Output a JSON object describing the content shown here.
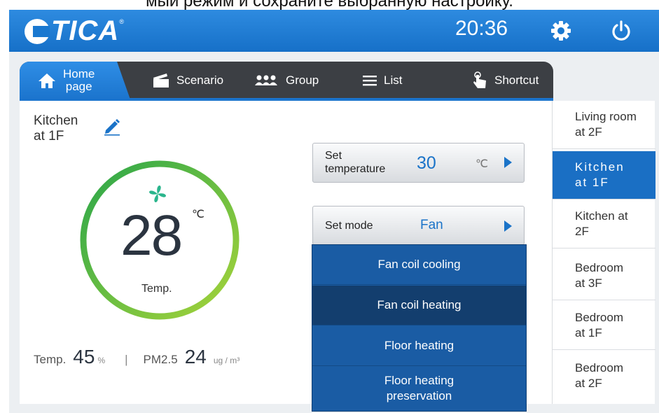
{
  "caption": "мый режим и сохраните выбранную настройку.",
  "header": {
    "logo": "TICA",
    "logo_reg": "®",
    "time": "20:36",
    "settings_icon": "gear-icon",
    "power_icon": "power-icon",
    "color": "#1a78d0"
  },
  "tabs": [
    {
      "label": "Home\npage",
      "icon": "home-icon",
      "active": true
    },
    {
      "label": "Scenario",
      "icon": "clapperboard-icon"
    },
    {
      "label": "Group",
      "icon": "group-icon"
    },
    {
      "label": "List",
      "icon": "list-icon"
    },
    {
      "label": "Shortcut",
      "icon": "tap-icon"
    }
  ],
  "main": {
    "room_title": "Kitchen\nat 1F",
    "edit_icon": "pencil-icon",
    "gauge": {
      "value": "28",
      "unit": "℃",
      "label": "Temp.",
      "ring_colors": [
        "#2aa64a",
        "#a7d43a"
      ]
    },
    "fan_icon": "fan-icon",
    "stats": {
      "temp_label": "Temp.",
      "humidity_value": "45",
      "humidity_unit": "%",
      "separator": "|",
      "pm_label": "PM2.5",
      "pm_value": "24",
      "pm_unit": "ug / m³"
    },
    "set_temperature": {
      "label": "Set\ntemperature",
      "value": "30",
      "unit": "℃"
    },
    "set_mode": {
      "label": "Set mode",
      "value": "Fan"
    },
    "mode_options": [
      {
        "label": "Fan coil cooling"
      },
      {
        "label": "Fan coil heating",
        "selected": true
      },
      {
        "label": "Floor heating"
      },
      {
        "label": "Floor heating\npreservation"
      }
    ]
  },
  "rooms": [
    {
      "label": "Living room\nat 2F"
    },
    {
      "label": "Kitchen\nat 1F",
      "active": true
    },
    {
      "label": "Kitchen at\n2F"
    },
    {
      "label": "Bedroom\nat 3F"
    },
    {
      "label": "Bedroom\nat 1F"
    },
    {
      "label": "Bedroom\nat 2F"
    }
  ],
  "colors": {
    "accent": "#1a73c8",
    "tabbar": "#3c3f44",
    "dropdown": "#1a5ca4",
    "dropdown_selected": "#133e6e"
  }
}
